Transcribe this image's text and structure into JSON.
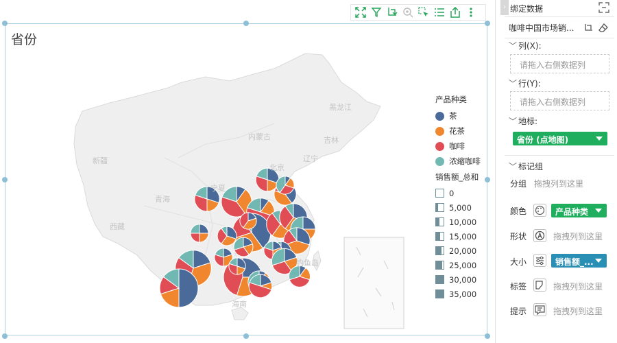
{
  "chart": {
    "title": "省份",
    "toolbar_icons": [
      "fullscreen-icon",
      "filter-icon",
      "drill-icon",
      "zoom-icon",
      "select-icon",
      "list-icon",
      "export-icon",
      "more-icon"
    ],
    "map_labels": [
      {
        "text": "黑龙江"
      },
      {
        "text": "内蒙古"
      },
      {
        "text": "吉林"
      },
      {
        "text": "新疆"
      },
      {
        "text": "辽宁"
      },
      {
        "text": "北京"
      },
      {
        "text": "宁夏"
      },
      {
        "text": "青海"
      },
      {
        "text": "西藏"
      },
      {
        "text": "钓鱼岛"
      },
      {
        "text": "海南"
      }
    ]
  },
  "chart_data": {
    "type": "pie",
    "subtype": "map-pie",
    "title": "省份",
    "color_legend": {
      "title": "产品种类",
      "items": [
        {
          "name": "茶",
          "color": "#4a6b9a"
        },
        {
          "name": "花茶",
          "color": "#f0862d"
        },
        {
          "name": "咖啡",
          "color": "#e14d55"
        },
        {
          "name": "浓缩咖啡",
          "color": "#72b8b2"
        }
      ]
    },
    "size_legend": {
      "title": "销售额_总和",
      "values": [
        "0",
        "5,000",
        "10,000",
        "15,000",
        "20,000",
        "25,000",
        "30,000",
        "35,000"
      ]
    },
    "pies": [
      {
        "values": [
          20,
          35,
          30,
          15
        ],
        "total": 30000
      },
      {
        "values": [
          25,
          30,
          45,
          0
        ],
        "total": 35000
      },
      {
        "values": [
          30,
          20,
          30,
          20
        ],
        "total": 12000
      },
      {
        "values": [
          10,
          30,
          40,
          20
        ],
        "total": 20000
      },
      {
        "values": [
          30,
          20,
          30,
          20
        ],
        "total": 10000
      },
      {
        "values": [
          40,
          40,
          10,
          10
        ],
        "total": 9000
      },
      {
        "values": [
          10,
          20,
          50,
          20
        ],
        "total": 16000
      },
      {
        "values": [
          40,
          30,
          20,
          10
        ],
        "total": 35000
      },
      {
        "values": [
          30,
          30,
          30,
          10
        ],
        "total": 16000
      },
      {
        "values": [
          30,
          30,
          30,
          10
        ],
        "total": 16000
      },
      {
        "values": [
          25,
          25,
          25,
          25
        ],
        "total": 12000
      },
      {
        "values": [
          30,
          40,
          20,
          10
        ],
        "total": 14000
      },
      {
        "values": [
          35,
          25,
          25,
          15
        ],
        "total": 7000
      },
      {
        "values": [
          25,
          25,
          25,
          25
        ],
        "total": 5000
      },
      {
        "values": [
          30,
          30,
          30,
          10
        ],
        "total": 6000
      },
      {
        "values": [
          20,
          20,
          30,
          30
        ],
        "total": 6000
      },
      {
        "values": [
          20,
          30,
          30,
          20
        ],
        "total": 5000
      },
      {
        "values": [
          20,
          20,
          30,
          30
        ],
        "total": 13000
      },
      {
        "values": [
          50,
          20,
          15,
          15
        ],
        "total": 35000
      },
      {
        "values": [
          10,
          20,
          30,
          40
        ],
        "total": 9000
      },
      {
        "values": [
          10,
          20,
          40,
          30
        ],
        "total": 8000
      },
      {
        "values": [
          20,
          30,
          30,
          20
        ],
        "total": 5000
      },
      {
        "values": [
          30,
          20,
          30,
          20
        ],
        "total": 4000
      },
      {
        "values": [
          20,
          40,
          40,
          0
        ],
        "total": 4000
      },
      {
        "values": [
          20,
          10,
          50,
          20
        ],
        "total": 10000
      },
      {
        "values": [
          10,
          20,
          30,
          40
        ],
        "total": 5000
      }
    ]
  },
  "panel": {
    "title": "绑定数据",
    "dataset_name": "咖啡中国市场销...",
    "columns_label": "列(X):",
    "columns_placeholder": "请拖入右侧数据列",
    "rows_label": "行(Y):",
    "rows_placeholder": "请拖入右侧数据列",
    "geo_label": "地标:",
    "geo_field": "省份 (点地图)",
    "marks_label": "标记组",
    "group_label": "分组",
    "group_hint": "拖拽列到这里",
    "color_label": "颜色",
    "color_field": "产品种类",
    "shape_label": "形状",
    "shape_hint": "拖拽列到这里",
    "size_label": "大小",
    "size_field": "销售额_...",
    "tag_label": "标签",
    "tag_hint": "拖拽列到这里",
    "tip_label": "提示",
    "tip_hint": "拖拽列到这里",
    "colors": {
      "green": "#1fae5e",
      "blue": "#2a8fb4",
      "accent": "#27a55a"
    }
  }
}
